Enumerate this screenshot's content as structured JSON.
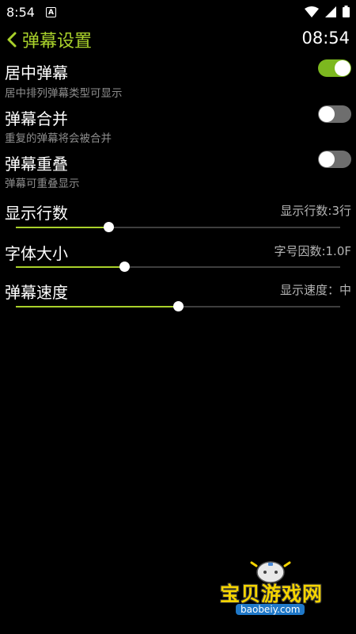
{
  "status_bar": {
    "time": "8:54",
    "app_icon_letter": "A"
  },
  "header": {
    "title": "弹幕设置",
    "clock": "08:54"
  },
  "colors": {
    "accent": "#a9d12b",
    "switch_on": "#7cb81f",
    "switch_off": "#6e6e6e"
  },
  "toggles": [
    {
      "title": "居中弹幕",
      "subtitle": "居中排列弹幕类型可显示",
      "on": true
    },
    {
      "title": "弹幕合并",
      "subtitle": "重复的弹幕将会被合并",
      "on": false
    },
    {
      "title": "弹幕重叠",
      "subtitle": "弹幕可重叠显示",
      "on": false
    }
  ],
  "sliders": [
    {
      "title": "显示行数",
      "value_text": "显示行数:3行",
      "fraction": 0.285
    },
    {
      "title": "字体大小",
      "value_text": "字号因数:1.0F",
      "fraction": 0.333
    },
    {
      "title": "弹幕速度",
      "value_text": "显示速度：中",
      "fraction": 0.5
    }
  ],
  "watermark": {
    "text": "宝贝游戏网",
    "url": "baobeiy.com"
  }
}
